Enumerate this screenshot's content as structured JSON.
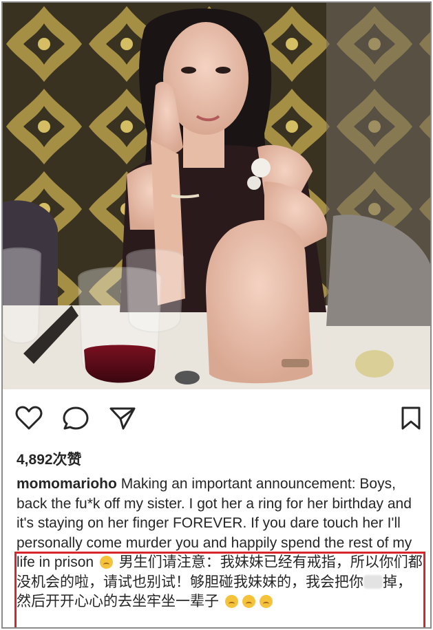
{
  "post": {
    "likes_label": "4,892次赞",
    "username": "momomarioho",
    "caption_en": "Making an important announcement: Boys, back the fu*k off my sister. I got her a ring for her birthday and it's staying on her finger FOREVER. If you dare touch her I'll personally come murder you and happily spend the rest of my life in prison",
    "caption_cn_1": "男生们请注意：我妹妹已经有戒指，所以你们都没机会的啦，请试也别试！够胆碰我妹妹的，我会把你",
    "caption_cn_2": "掉，然后开开心心的去坐牢坐一辈子"
  },
  "icons": {
    "like": "heart-icon",
    "comment": "comment-bubble-icon",
    "share": "send-paper-plane-icon",
    "save": "bookmark-icon"
  },
  "colors": {
    "highlight": "#d7262b",
    "text": "#262626"
  }
}
